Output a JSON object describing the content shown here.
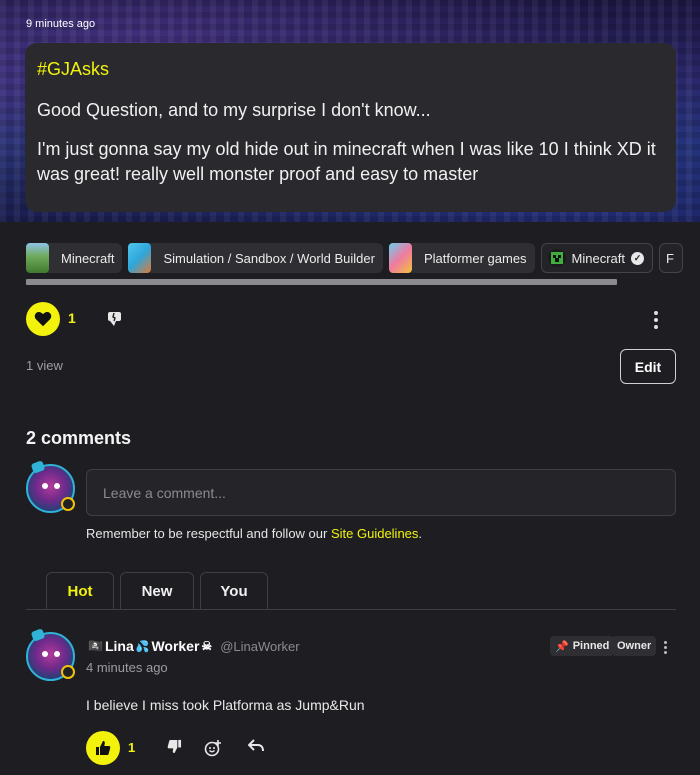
{
  "post": {
    "timestamp": "9 minutes ago",
    "hashtag": "#GJAsks",
    "paragraphs": [
      "Good Question, and to my surprise I don't know...",
      "I'm just gonna say my old hide out in minecraft when I was like 10 I think XD it was great! really well monster proof and easy to master"
    ]
  },
  "tags": [
    {
      "label": "Minecraft",
      "color": "#3f7a2e"
    },
    {
      "label": "Simulation / Sandbox / World Builder",
      "color": "#2fa6d9"
    },
    {
      "label": "Platformer games",
      "color": "#d94a6b"
    },
    {
      "label": "Minecraft",
      "icon": "creeper-icon"
    },
    {
      "label": "F"
    }
  ],
  "actions": {
    "like_count": "1",
    "views": "1 view",
    "edit_label": "Edit"
  },
  "comments": {
    "title": "2 comments",
    "placeholder": "Leave a comment...",
    "guidelines_prefix": "Remember to be respectful and follow our ",
    "guidelines_link": "Site Guidelines",
    "guidelines_suffix": ".",
    "tabs": [
      "Hot",
      "New",
      "You"
    ],
    "active_tab": "Hot",
    "items": [
      {
        "display_name": "Lina",
        "display_name_2": "Worker",
        "handle": "@LinaWorker",
        "time": "4 minutes ago",
        "pinned_label": "Pinned",
        "owner_label": "Owner",
        "text": "I believe I miss took Platforma as Jump&Run",
        "like_count": "1"
      }
    ]
  },
  "colors": {
    "accent": "#f2f20d",
    "background": "#1e1e22",
    "card": "#2a2a2e"
  }
}
